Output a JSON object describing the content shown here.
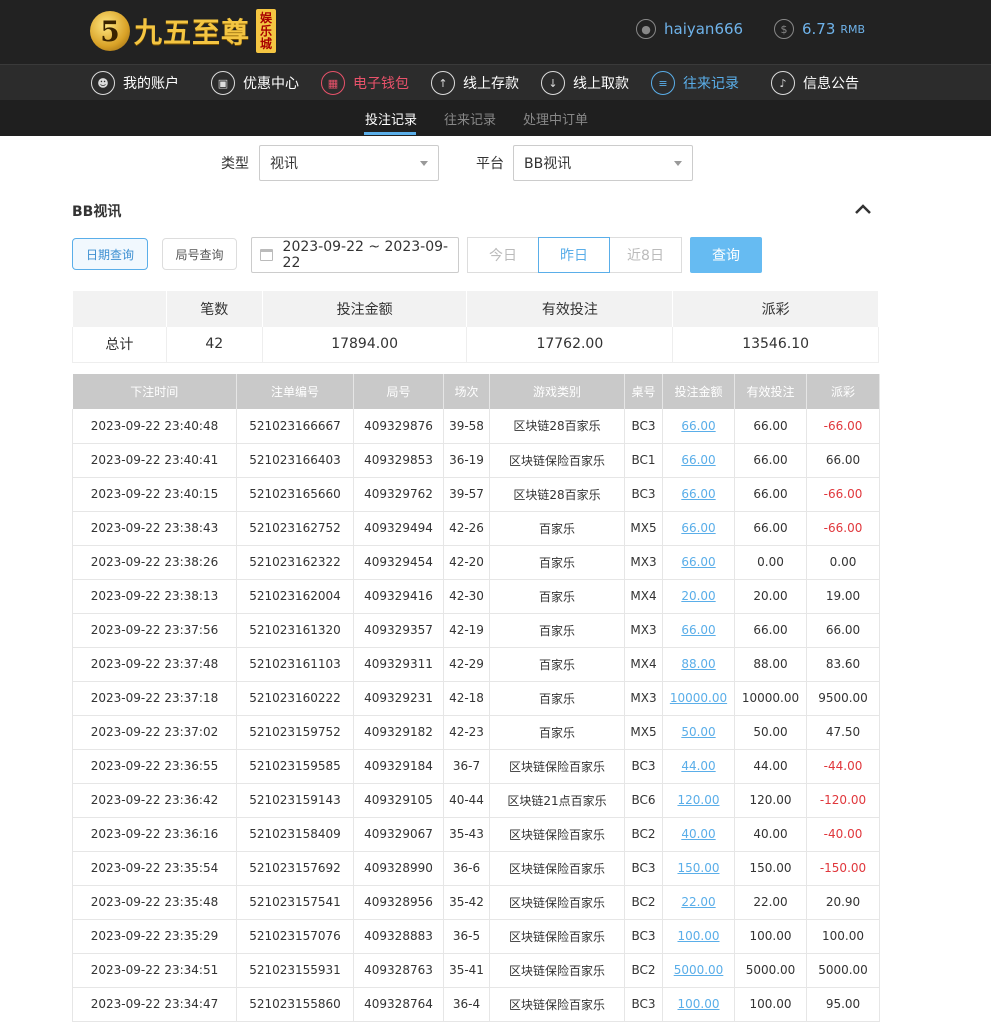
{
  "brand": {
    "badge": "5",
    "name": "九五至尊",
    "seal": [
      "娱",
      "乐",
      "城"
    ]
  },
  "user": {
    "username": "haiyan666",
    "balance": "6.73",
    "currency": "RMB"
  },
  "main_nav": [
    {
      "label": "我的账户",
      "icon": "user-icon"
    },
    {
      "label": "优惠中心",
      "icon": "gift-icon"
    },
    {
      "label": "电子钱包",
      "icon": "wallet-icon"
    },
    {
      "label": "线上存款",
      "icon": "deposit-icon"
    },
    {
      "label": "线上取款",
      "icon": "withdraw-icon"
    },
    {
      "label": "往来记录",
      "icon": "records-icon"
    },
    {
      "label": "信息公告",
      "icon": "bell-icon"
    }
  ],
  "sub_nav": [
    "投注记录",
    "往来记录",
    "处理中订单"
  ],
  "filters": {
    "type_label": "类型",
    "type_value": "视讯",
    "platform_label": "平台",
    "platform_value": "BB视讯"
  },
  "section": {
    "title": "BB视讯",
    "date_query": "日期查询",
    "round_query": "局号查询",
    "date_range": "2023-09-22 ~ 2023-09-22",
    "quick": [
      "今日",
      "昨日",
      "近8日"
    ],
    "search": "查询"
  },
  "summary": {
    "headers": [
      "",
      "笔数",
      "投注金额",
      "有效投注",
      "派彩"
    ],
    "row": [
      "总计",
      "42",
      "17894.00",
      "17762.00",
      "13546.10"
    ]
  },
  "table": {
    "headers": [
      "下注时间",
      "注单编号",
      "局号",
      "场次",
      "游戏类别",
      "桌号",
      "投注金额",
      "有效投注",
      "派彩"
    ],
    "rows": [
      [
        "2023-09-22 23:40:48",
        "521023166667",
        "409329876",
        "39-58",
        "区块链28百家乐",
        "BC3",
        "66.00",
        "66.00",
        "-66.00"
      ],
      [
        "2023-09-22 23:40:41",
        "521023166403",
        "409329853",
        "36-19",
        "区块链保险百家乐",
        "BC1",
        "66.00",
        "66.00",
        "66.00"
      ],
      [
        "2023-09-22 23:40:15",
        "521023165660",
        "409329762",
        "39-57",
        "区块链28百家乐",
        "BC3",
        "66.00",
        "66.00",
        "-66.00"
      ],
      [
        "2023-09-22 23:38:43",
        "521023162752",
        "409329494",
        "42-26",
        "百家乐",
        "MX5",
        "66.00",
        "66.00",
        "-66.00"
      ],
      [
        "2023-09-22 23:38:26",
        "521023162322",
        "409329454",
        "42-20",
        "百家乐",
        "MX3",
        "66.00",
        "0.00",
        "0.00"
      ],
      [
        "2023-09-22 23:38:13",
        "521023162004",
        "409329416",
        "42-30",
        "百家乐",
        "MX4",
        "20.00",
        "20.00",
        "19.00"
      ],
      [
        "2023-09-22 23:37:56",
        "521023161320",
        "409329357",
        "42-19",
        "百家乐",
        "MX3",
        "66.00",
        "66.00",
        "66.00"
      ],
      [
        "2023-09-22 23:37:48",
        "521023161103",
        "409329311",
        "42-29",
        "百家乐",
        "MX4",
        "88.00",
        "88.00",
        "83.60"
      ],
      [
        "2023-09-22 23:37:18",
        "521023160222",
        "409329231",
        "42-18",
        "百家乐",
        "MX3",
        "10000.00",
        "10000.00",
        "9500.00"
      ],
      [
        "2023-09-22 23:37:02",
        "521023159752",
        "409329182",
        "42-23",
        "百家乐",
        "MX5",
        "50.00",
        "50.00",
        "47.50"
      ],
      [
        "2023-09-22 23:36:55",
        "521023159585",
        "409329184",
        "36-7",
        "区块链保险百家乐",
        "BC3",
        "44.00",
        "44.00",
        "-44.00"
      ],
      [
        "2023-09-22 23:36:42",
        "521023159143",
        "409329105",
        "40-44",
        "区块链21点百家乐",
        "BC6",
        "120.00",
        "120.00",
        "-120.00"
      ],
      [
        "2023-09-22 23:36:16",
        "521023158409",
        "409329067",
        "35-43",
        "区块链保险百家乐",
        "BC2",
        "40.00",
        "40.00",
        "-40.00"
      ],
      [
        "2023-09-22 23:35:54",
        "521023157692",
        "409328990",
        "36-6",
        "区块链保险百家乐",
        "BC3",
        "150.00",
        "150.00",
        "-150.00"
      ],
      [
        "2023-09-22 23:35:48",
        "521023157541",
        "409328956",
        "35-42",
        "区块链保险百家乐",
        "BC2",
        "22.00",
        "22.00",
        "20.90"
      ],
      [
        "2023-09-22 23:35:29",
        "521023157076",
        "409328883",
        "36-5",
        "区块链保险百家乐",
        "BC3",
        "100.00",
        "100.00",
        "100.00"
      ],
      [
        "2023-09-22 23:34:51",
        "521023155931",
        "409328763",
        "35-41",
        "区块链保险百家乐",
        "BC2",
        "5000.00",
        "5000.00",
        "5000.00"
      ],
      [
        "2023-09-22 23:34:47",
        "521023155860",
        "409328764",
        "36-4",
        "区块链保险百家乐",
        "BC3",
        "100.00",
        "100.00",
        "95.00"
      ]
    ]
  },
  "colors": {
    "accent": "#5aaee9",
    "negative": "#e0373c",
    "wallet": "#e8526a",
    "header_bg": "#222222"
  }
}
